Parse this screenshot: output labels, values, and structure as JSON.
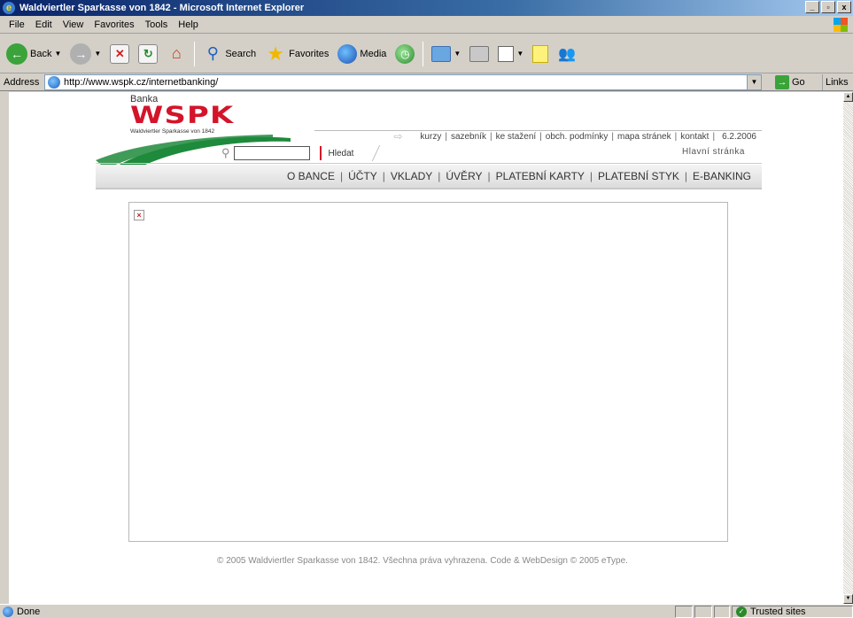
{
  "window": {
    "title": "Waldviertler Sparkasse von 1842 - Microsoft Internet Explorer",
    "controls": {
      "minimize": "_",
      "maximize": "▫",
      "close": "x"
    }
  },
  "menubar": {
    "items": [
      "File",
      "Edit",
      "View",
      "Favorites",
      "Tools",
      "Help"
    ]
  },
  "toolbar": {
    "back_label": "Back",
    "search_label": "Search",
    "favorites_label": "Favorites",
    "media_label": "Media"
  },
  "addressbar": {
    "label": "Address",
    "url": "http://www.wspk.cz/internetbanking/",
    "go_label": "Go",
    "links_label": "Links"
  },
  "site": {
    "logo": {
      "pre": "Banka",
      "name": "WSPK",
      "sub": "Waldviertler Sparkasse von 1842"
    },
    "top_links": [
      "kurzy",
      "sazebník",
      "ke stažení",
      "obch. podmínky",
      "mapa stránek",
      "kontakt"
    ],
    "date": "6.2.2006",
    "search_button": "Hledat",
    "home_link": "Hlavní stránka",
    "nav": [
      "O BANCE",
      "ÚČTY",
      "VKLADY",
      "ÚVĚRY",
      "PLATEBNÍ KARTY",
      "PLATEBNÍ STYK",
      "E-BANKING"
    ],
    "footer": "© 2005 Waldviertler Sparkasse von 1842. Všechna práva vyhrazena. Code & WebDesign © 2005 eType.",
    "brand_color": "#d4142a",
    "swoosh_color": "#1e8a3c"
  },
  "statusbar": {
    "text": "Done",
    "zone": "Trusted sites"
  }
}
